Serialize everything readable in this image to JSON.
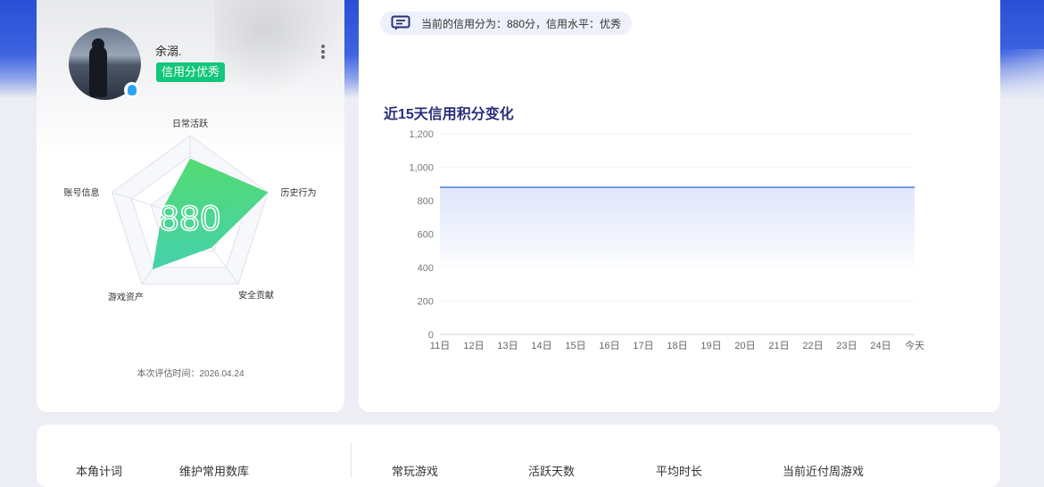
{
  "profile": {
    "username": "余溺.",
    "level_badge": "信用分优秀",
    "score": "880",
    "radar": {
      "labels": [
        "日常活跃",
        "历史行为",
        "安全贡献",
        "游戏资产",
        "账号信息"
      ],
      "values": [
        0.72,
        1.0,
        0.45,
        0.78,
        0.35
      ],
      "fill_top": "#4ad96a",
      "fill_bottom": "#3ccfa8"
    },
    "eval_time": "本次评估时间：2026.04.24"
  },
  "credit_summary": "当前的信用分为：880分，信用水平：优秀",
  "chart_title": "近15天信用积分变化",
  "chart_data": {
    "type": "area",
    "categories": [
      "11日",
      "12日",
      "13日",
      "14日",
      "15日",
      "16日",
      "17日",
      "18日",
      "19日",
      "20日",
      "21日",
      "22日",
      "23日",
      "24日",
      "今天"
    ],
    "series": [
      {
        "values": [
          880,
          880,
          880,
          880,
          880,
          880,
          880,
          880,
          880,
          880,
          880,
          880,
          880,
          880,
          880
        ]
      }
    ],
    "ylim": [
      0,
      1200
    ],
    "yticks": [
      "0",
      "200",
      "400",
      "600",
      "800",
      "1,000",
      "1,200"
    ],
    "line_color": "#7b96e0",
    "grid": true
  },
  "bottom_stats": {
    "items": [
      "本角计词",
      "维护常用数库",
      "常玩游戏",
      "活跃天数",
      "平均时长",
      "当前近付周游戏"
    ]
  }
}
